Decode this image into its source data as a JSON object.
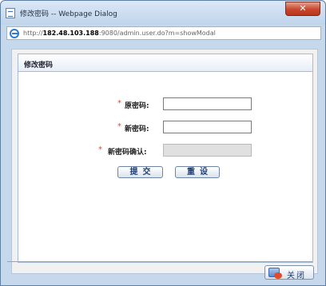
{
  "window": {
    "title": "修改密码 -- Webpage Dialog",
    "close_glyph": "✕"
  },
  "address": {
    "prefix": "http://",
    "host": "182.48.103.188",
    "rest": ":9080/admin.user.do?m=showModal"
  },
  "panel": {
    "title": "修改密码"
  },
  "form": {
    "required_mark": "*",
    "old_password_label": "原密码:",
    "new_password_label": "新密码:",
    "confirm_password_label": "新密码确认:"
  },
  "buttons": {
    "submit": "提交",
    "reset": "重设",
    "close": "关闭"
  },
  "colors": {
    "required": "#e64b1f",
    "button_text": "#1f3c72"
  }
}
